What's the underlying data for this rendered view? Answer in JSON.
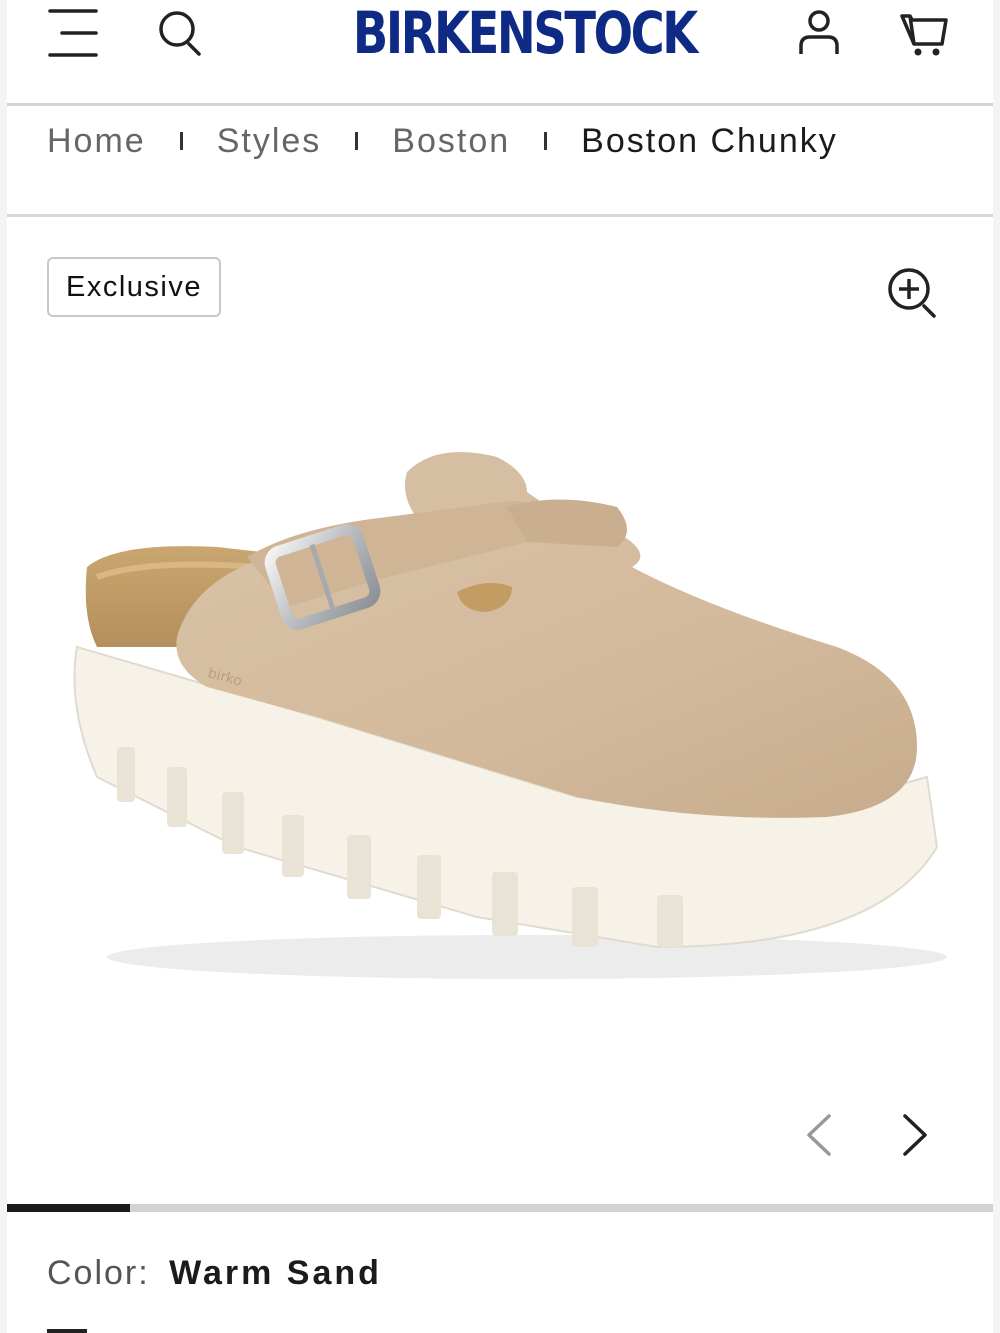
{
  "header": {
    "logo_text": "BIRKENSTOCK",
    "logo_reg": "®",
    "brand_color": "#0e2a84"
  },
  "breadcrumb": {
    "items": [
      {
        "label": "Home"
      },
      {
        "label": "Styles"
      },
      {
        "label": "Boston"
      },
      {
        "label": "Boston Chunky"
      }
    ]
  },
  "gallery": {
    "badge": "Exclusive",
    "image_progress": 0.125
  },
  "product": {
    "color_label": "Color:",
    "color_value": "Warm Sand"
  },
  "icons": {
    "menu": "menu-icon",
    "search": "search-icon",
    "account": "account-icon",
    "cart": "cart-icon",
    "zoom": "zoom-in-icon",
    "prev": "chevron-left-icon",
    "next": "chevron-right-icon"
  }
}
